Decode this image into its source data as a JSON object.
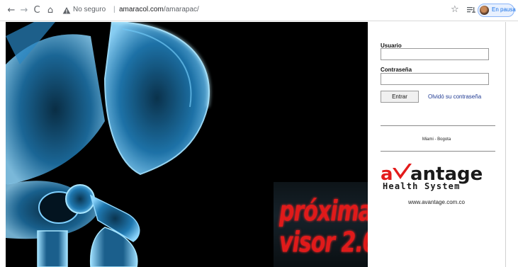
{
  "browser": {
    "nav": {
      "back": "←",
      "forward": "→",
      "reload": "C",
      "home": "⌂"
    },
    "address": {
      "security_text": "No seguro",
      "separator": "|",
      "domain": "amaracol.com",
      "path": "/amarapac/"
    },
    "profile": {
      "status": "En pausa"
    },
    "icons": [
      "arrow-left-icon",
      "arrow-right-icon",
      "reload-icon",
      "home-icon",
      "warning-icon",
      "star-icon",
      "reading-list-icon",
      "avatar"
    ]
  },
  "hero": {
    "promo_line1": "próxima",
    "promo_line2": "visor 2.0"
  },
  "login": {
    "username_label": "Usuario",
    "username_value": "",
    "password_label": "Contraseña",
    "password_value": "",
    "submit_label": "Entrar",
    "forgot_link": "Olvidó su contraseña",
    "cities": "Miami - Bogota",
    "logo_brand": "avantage",
    "logo_tagline": "Health System",
    "website": "www.avantage.com.co"
  },
  "colors": {
    "logo_red": "#e31b1b",
    "logo_dark": "#1a1a1a",
    "link": "#1f3a93",
    "pause_blue": "#1a73e8",
    "bone_blue": "#4fb3e8"
  }
}
